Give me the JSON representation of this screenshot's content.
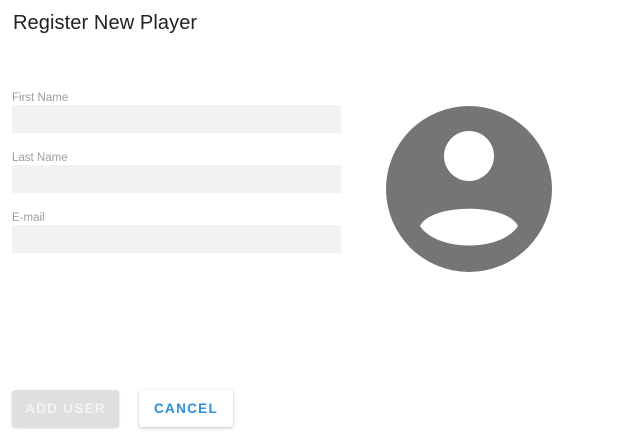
{
  "dialog": {
    "title": "Register New Player"
  },
  "form": {
    "first_name": {
      "label": "First Name",
      "value": ""
    },
    "last_name": {
      "label": "Last Name",
      "value": ""
    },
    "email": {
      "label": "E-mail",
      "value": ""
    }
  },
  "avatar": {
    "icon": "account-circle-icon",
    "color": "#757575"
  },
  "actions": {
    "add_label": "ADD USER",
    "cancel_label": "CANCEL"
  },
  "colors": {
    "input_bg": "#f2f2f2",
    "cancel_text": "#2b8fd8",
    "disabled_bg": "#dfdfdf"
  }
}
